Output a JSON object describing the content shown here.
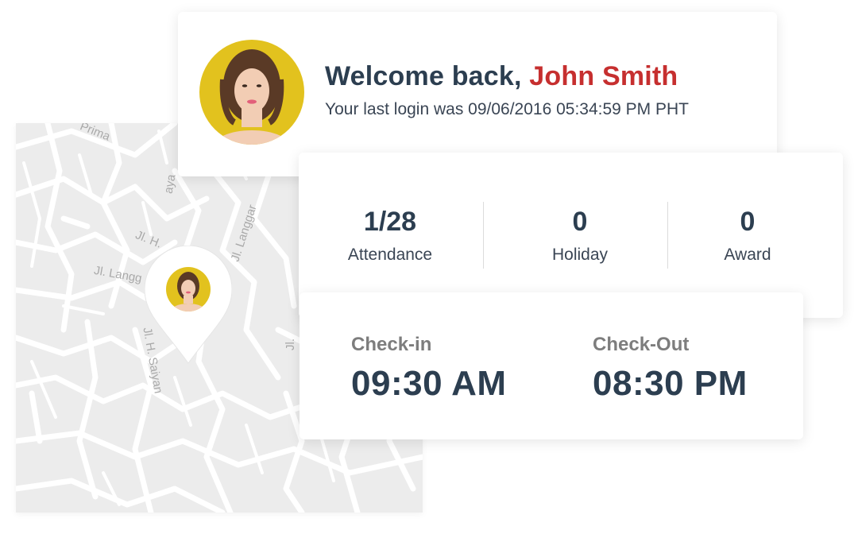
{
  "welcome": {
    "greeting": "Welcome back,",
    "user_name": "John Smith",
    "last_login": "Your last login was 09/06/2016 05:34:59 PM PHT"
  },
  "stats": [
    {
      "value": "1/28",
      "label": "Attendance"
    },
    {
      "value": "0",
      "label": "Holiday"
    },
    {
      "value": "0",
      "label": "Award"
    }
  ],
  "check": {
    "in_label": "Check-in",
    "in_time": "09:30 AM",
    "out_label": "Check-Out",
    "out_time": "08:30 PM"
  },
  "map": {
    "streets": [
      "Prima",
      "Jl. Langgar",
      "Jl. H.",
      "Jl. Langg",
      "Jl. H. Saiyan",
      "aya",
      "Jl."
    ]
  },
  "colors": {
    "accent_red": "#c62f2f",
    "text_dark": "#2c3e50",
    "text_muted": "#7d7d7d",
    "map_background": "#ececec",
    "avatar_background": "#e2c21e"
  }
}
